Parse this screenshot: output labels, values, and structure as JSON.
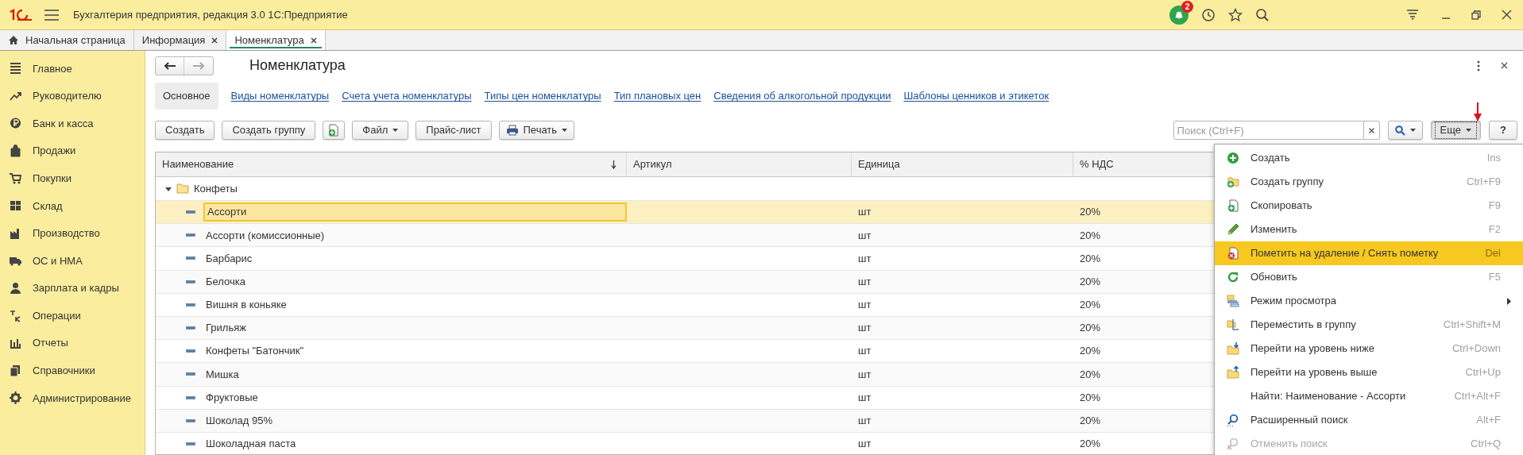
{
  "window": {
    "title": "Бухгалтерия предприятия, редакция 3.0 1С:Предприятие",
    "notifications_badge": "2"
  },
  "tabs": [
    {
      "label": "Начальная страница",
      "kind": "home",
      "selected": false
    },
    {
      "label": "Информация",
      "kind": "closable",
      "selected": false
    },
    {
      "label": "Номенклатура",
      "kind": "closable",
      "selected": true
    }
  ],
  "sidebar": {
    "items": [
      {
        "label": "Главное"
      },
      {
        "label": "Руководителю"
      },
      {
        "label": "Банк и касса"
      },
      {
        "label": "Продажи"
      },
      {
        "label": "Покупки"
      },
      {
        "label": "Склад"
      },
      {
        "label": "Производство"
      },
      {
        "label": "ОС и НМА"
      },
      {
        "label": "Зарплата и кадры"
      },
      {
        "label": "Операции"
      },
      {
        "label": "Отчеты"
      },
      {
        "label": "Справочники"
      },
      {
        "label": "Администрирование"
      }
    ]
  },
  "form": {
    "title": "Номенклатура",
    "links": [
      {
        "label": "Основное",
        "selected": true
      },
      {
        "label": "Виды номенклатуры",
        "selected": false
      },
      {
        "label": "Счета учета номенклатуры",
        "selected": false
      },
      {
        "label": "Типы цен номенклатуры",
        "selected": false
      },
      {
        "label": "Тип плановых цен",
        "selected": false
      },
      {
        "label": "Сведения об алкогольной продукции",
        "selected": false
      },
      {
        "label": "Шаблоны ценников и этикеток",
        "selected": false
      }
    ],
    "toolbar": [
      {
        "kind": "plain",
        "label": "Создать"
      },
      {
        "kind": "plain",
        "label": "Создать группу"
      },
      {
        "kind": "icon"
      },
      {
        "kind": "dropdown",
        "label": "Файл"
      },
      {
        "kind": "plain",
        "label": "Прайс-лист"
      },
      {
        "kind": "print-dropdown",
        "label": "Печать"
      }
    ],
    "search": {
      "placeholder": "Поиск (Ctrl+F)"
    },
    "more_button": {
      "label": "Еще",
      "pressed": true
    },
    "help_button": {
      "label": "?"
    }
  },
  "table": {
    "columns": [
      "Наименование",
      "Артикул",
      "Единица",
      "% НДС"
    ],
    "group": {
      "name": "Конфеты",
      "expanded": true
    },
    "rows": [
      {
        "name": "Ассорти",
        "unit": "шт",
        "vat": "20%",
        "selected": true
      },
      {
        "name": "Ассорти (комиссионные)",
        "unit": "шт",
        "vat": "20%",
        "selected": false
      },
      {
        "name": "Барбарис",
        "unit": "шт",
        "vat": "20%",
        "selected": false
      },
      {
        "name": "Белочка",
        "unit": "шт",
        "vat": "20%",
        "selected": false
      },
      {
        "name": "Вишня в коньяке",
        "unit": "шт",
        "vat": "20%",
        "selected": false
      },
      {
        "name": "Грильяж",
        "unit": "шт",
        "vat": "20%",
        "selected": false
      },
      {
        "name": "Конфеты \"Батончик\"",
        "unit": "шт",
        "vat": "20%",
        "selected": false
      },
      {
        "name": "Мишка",
        "unit": "шт",
        "vat": "20%",
        "selected": false
      },
      {
        "name": "Фруктовые",
        "unit": "шт",
        "vat": "20%",
        "selected": false
      },
      {
        "name": "Шоколад 95%",
        "unit": "шт",
        "vat": "20%",
        "selected": false
      },
      {
        "name": "Шоколадная паста",
        "unit": "шт",
        "vat": "20%",
        "selected": false
      }
    ]
  },
  "more_menu": {
    "items": [
      {
        "kind": "command",
        "label": "Создать",
        "shortcut": "Ins",
        "selected": false,
        "disabled": false
      },
      {
        "kind": "command",
        "label": "Создать группу",
        "shortcut": "Ctrl+F9",
        "selected": false,
        "disabled": false
      },
      {
        "kind": "command",
        "label": "Скопировать",
        "shortcut": "F9",
        "selected": false,
        "disabled": false
      },
      {
        "kind": "command",
        "label": "Изменить",
        "shortcut": "F2",
        "selected": false,
        "disabled": false
      },
      {
        "kind": "command",
        "label": "Пометить на удаление / Снять пометку",
        "shortcut": "Del",
        "selected": true,
        "disabled": false
      },
      {
        "kind": "command",
        "label": "Обновить",
        "shortcut": "F5",
        "selected": false,
        "disabled": false
      },
      {
        "kind": "submenu",
        "label": "Режим просмотра",
        "selected": false,
        "disabled": false
      },
      {
        "kind": "command",
        "label": "Переместить в группу",
        "shortcut": "Ctrl+Shift+M",
        "selected": false,
        "disabled": false
      },
      {
        "kind": "command",
        "label": "Перейти на уровень ниже",
        "shortcut": "Ctrl+Down",
        "selected": false,
        "disabled": false
      },
      {
        "kind": "command",
        "label": "Перейти на уровень выше",
        "shortcut": "Ctrl+Up",
        "selected": false,
        "disabled": false
      },
      {
        "kind": "command",
        "label": "Найти: Наименование - Ассорти",
        "shortcut": "Ctrl+Alt+F",
        "selected": false,
        "disabled": false
      },
      {
        "kind": "command",
        "label": "Расширенный поиск",
        "shortcut": "Alt+F",
        "selected": false,
        "disabled": false
      },
      {
        "kind": "command",
        "label": "Отменить поиск",
        "shortcut": "Ctrl+Q",
        "selected": false,
        "disabled": true
      }
    ]
  }
}
